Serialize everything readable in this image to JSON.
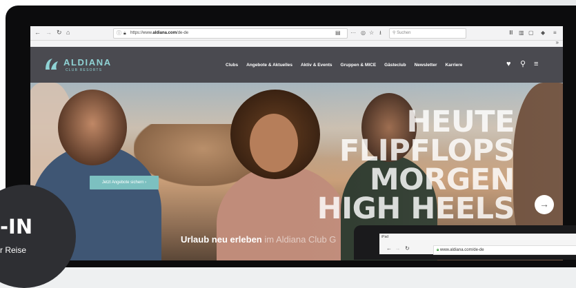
{
  "browser": {
    "back_glyph": "←",
    "forward_glyph": "→",
    "reload_glyph": "↻",
    "home_glyph": "⌂",
    "url_prefix": "https://www.",
    "url_domain": "aldiana.com",
    "url_path": "/de-de",
    "reader_glyph": "▤",
    "more_glyph": "···",
    "pocket_glyph": "◎",
    "bookmark_glyph": "☆",
    "download_glyph": "⭳",
    "search_placeholder": "Suchen",
    "library_glyph": "Ⅲ",
    "sidebar_glyph": "▥",
    "tabs_glyph": "▢",
    "menu_glyph": "≡",
    "overflow_glyph": "»"
  },
  "site": {
    "logo_name": "ALDIANA",
    "logo_sub": "CLUB RESORTS",
    "nav": [
      "Clubs",
      "Angebote & Aktuelles",
      "Aktiv & Events",
      "Gruppen & MICE",
      "Gästeclub",
      "Newsletter",
      "Karriere"
    ],
    "heart_glyph": "♥",
    "search_glyph": "⚲",
    "menu_glyph": "≡"
  },
  "hero": {
    "headline": [
      "HEUTE",
      "FLIPFLOPS",
      "MORGEN",
      "HIGH HEELS"
    ],
    "cta_label": "Jetzt Angebote sichern ›",
    "prev_glyph": "←",
    "next_glyph": "→",
    "tagline_main": "Urlaub neu erleben",
    "tagline_rest": " im Aldiana Club G"
  },
  "ipad": {
    "label": "iPad",
    "back": "←",
    "forward": "→",
    "reload": "↻",
    "url": "www.aldiana.com/de-de"
  },
  "badge": {
    "title": "-IN",
    "subtitle": "r Reise"
  },
  "colors": {
    "nav_bg": "#4a4a50",
    "brand_teal": "#8fd2d4",
    "cta_bg": "#7cc0c0"
  }
}
